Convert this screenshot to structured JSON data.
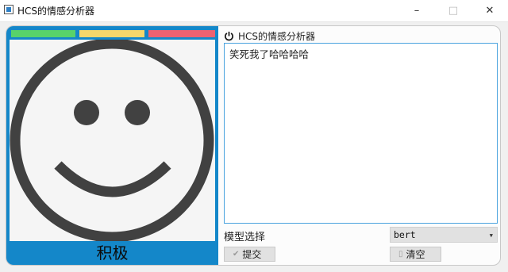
{
  "window": {
    "title": "HCS的情感分析器",
    "minimize_glyph": "–",
    "maximize_glyph": "□",
    "close_glyph": "✕"
  },
  "left_panel": {
    "sentiment_label": "积极",
    "face": "smiley-face-icon",
    "stripe_colors": {
      "green": "#58d26a",
      "yellow": "#f5d76b",
      "red": "#ec6272"
    }
  },
  "right_panel": {
    "header_title": "HCS的情感分析器",
    "input_text": "笑死我了哈哈哈哈",
    "model_label": "模型选择",
    "model_selected": "bert",
    "submit_label": "提交",
    "clear_label": "清空"
  },
  "colors": {
    "accent": "#1487c9",
    "input_border": "#4aa3df"
  }
}
